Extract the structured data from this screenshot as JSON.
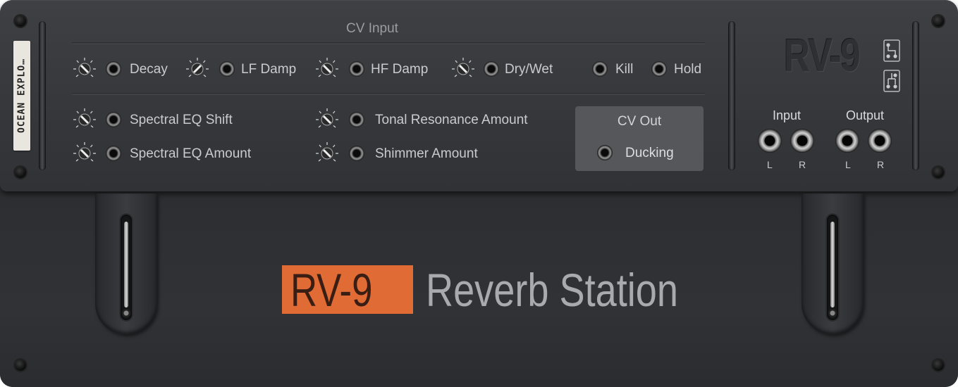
{
  "plugin": {
    "tape_label": "OCEAN EXPLO…",
    "model": "RV-9",
    "subtitle": "Reverb Station",
    "accent_color": "#e06b35"
  },
  "cv_input": {
    "title": "CV Input",
    "row1": [
      {
        "label": "Decay",
        "has_knob": true
      },
      {
        "label": "LF Damp",
        "has_knob": true
      },
      {
        "label": "HF Damp",
        "has_knob": true
      },
      {
        "label": "Dry/Wet",
        "has_knob": true
      },
      {
        "label": "Kill",
        "has_knob": false
      },
      {
        "label": "Hold",
        "has_knob": false
      }
    ],
    "row2": [
      {
        "label": "Spectral EQ Shift"
      },
      {
        "label": "Tonal Resonance Amount"
      }
    ],
    "row3": [
      {
        "label": "Spectral EQ Amount"
      },
      {
        "label": "Shimmer Amount"
      }
    ]
  },
  "cv_out": {
    "title": "CV Out",
    "items": [
      {
        "label": "Ducking"
      }
    ]
  },
  "audio_io": {
    "input_label": "Input",
    "output_label": "Output",
    "left": "L",
    "right": "R"
  },
  "icons": {
    "routing_top": "routing-series-icon",
    "routing_bottom": "routing-parallel-icon",
    "knob": "trim-knob-icon",
    "jack": "cv-jack-icon"
  }
}
